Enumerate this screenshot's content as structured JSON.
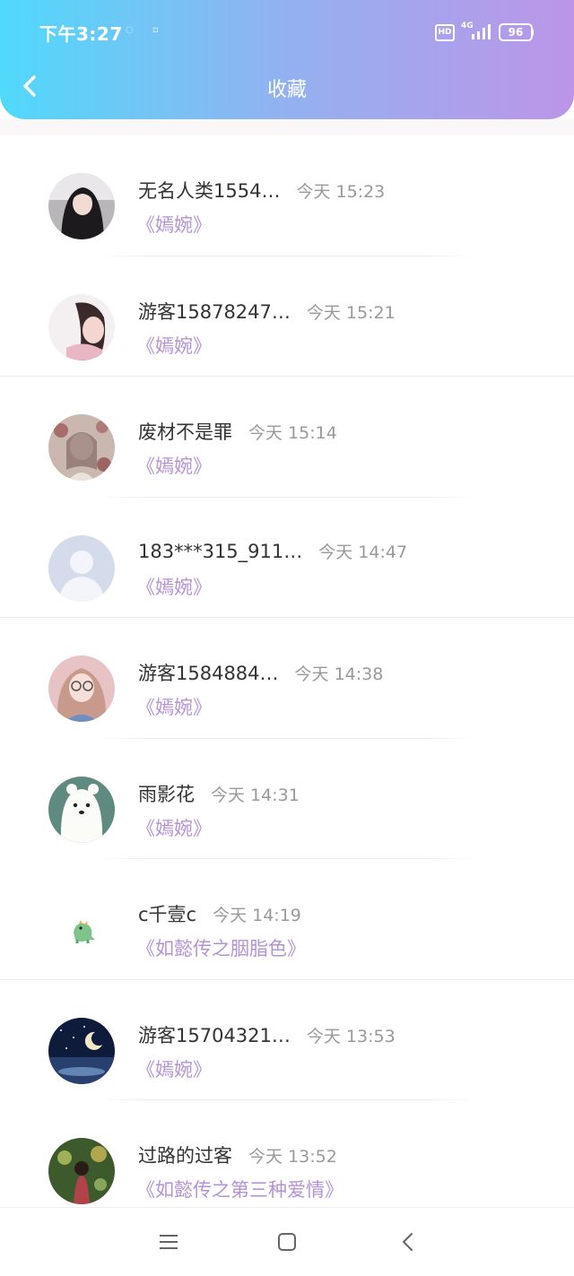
{
  "status_bar": {
    "time": "下午3:27",
    "hd": "HD",
    "network": "4G",
    "battery": "96"
  },
  "header": {
    "title": "收藏"
  },
  "items": [
    {
      "name": "无名人类1554…",
      "time": "今天 15:23",
      "book": "《嫣婉》"
    },
    {
      "name": "游客15878247…",
      "time": "今天 15:21",
      "book": "《嫣婉》"
    },
    {
      "name": "废材不是罪",
      "time": "今天 15:14",
      "book": "《嫣婉》"
    },
    {
      "name": "183***315_911…",
      "time": "今天 14:47",
      "book": "《嫣婉》"
    },
    {
      "name": "游客1584884…",
      "time": "今天 14:38",
      "book": "《嫣婉》"
    },
    {
      "name": "雨影花",
      "time": "今天 14:31",
      "book": "《嫣婉》"
    },
    {
      "name": "c千壹c",
      "time": "今天 14:19",
      "book": "《如懿传之胭脂色》"
    },
    {
      "name": "游客15704321…",
      "time": "今天 13:53",
      "book": "《嫣婉》"
    },
    {
      "name": "过路的过客",
      "time": "今天 13:52",
      "book": "《如懿传之第三种爱情》"
    }
  ],
  "colors": {
    "header_gradient": [
      "#50d9fb",
      "#93b1f0",
      "#bc95e8"
    ],
    "book_title": "#b492d6",
    "time": "#999999",
    "name": "#333333"
  },
  "icons": [
    "back-chevron-icon",
    "menu-icon",
    "home-square-icon",
    "back-triangle-icon"
  ]
}
